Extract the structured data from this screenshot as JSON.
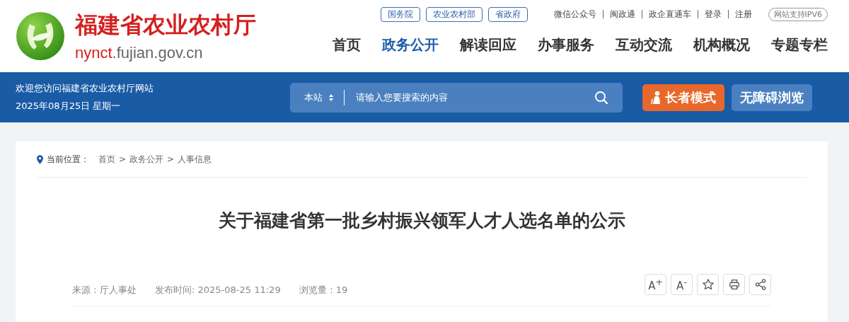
{
  "logo": {
    "title": "福建省农业农村厅",
    "domain_highlight": "nynct",
    "domain_rest": ".fujian.gov.cn"
  },
  "top_links": [
    "国务院",
    "农业农村部",
    "省政府"
  ],
  "utility_links": [
    "微信公众号",
    "闽政通",
    "政企直通车",
    "登录",
    "注册"
  ],
  "ipv6_badge": "网站支持IPV6",
  "nav": [
    {
      "label": "首页",
      "selected": false
    },
    {
      "label": "政务公开",
      "selected": true
    },
    {
      "label": "解读回应",
      "selected": false
    },
    {
      "label": "办事服务",
      "selected": false
    },
    {
      "label": "互动交流",
      "selected": false
    },
    {
      "label": "机构概况",
      "selected": false
    },
    {
      "label": "专题专栏",
      "selected": false
    }
  ],
  "banner": {
    "welcome": "欢迎您访问福建省农业农村厅网站",
    "date": "2025年08月25日 星期一"
  },
  "search": {
    "scope": "本站",
    "placeholder": "请输入您要搜索的内容"
  },
  "mode_buttons": [
    "长者模式",
    "无障碍浏览"
  ],
  "breadcrumb": {
    "label": "当前位置：",
    "items": [
      "首页",
      "政务公开",
      "人事信息"
    ],
    "separator": ">"
  },
  "article": {
    "title": "关于福建省第一批乡村振兴领军人才人选名单的公示",
    "meta": [
      "来源：厅人事处",
      "发布时间: 2025-08-25 11:29",
      "浏览量：19"
    ],
    "font_buttons": [
      "A$^{+}$",
      "A$^{-}$"
    ]
  }
}
